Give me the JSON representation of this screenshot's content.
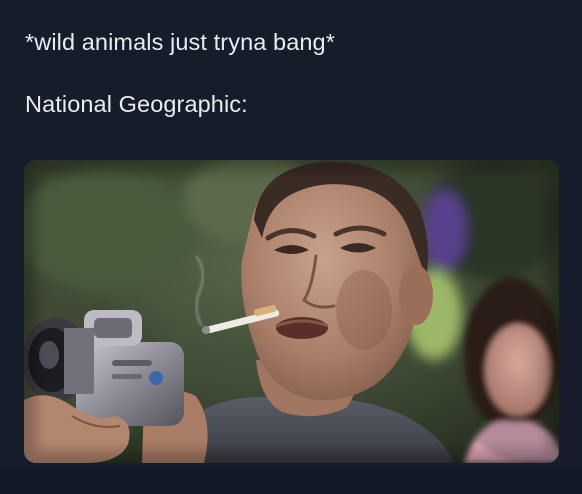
{
  "tweet": {
    "line1": "*wild animals just tryna bang*",
    "line2": "National Geographic:"
  },
  "media": {
    "subject": "man-with-camcorder-and-cigarette"
  },
  "colors": {
    "background": "#151d2b",
    "text": "#e9edf2"
  }
}
